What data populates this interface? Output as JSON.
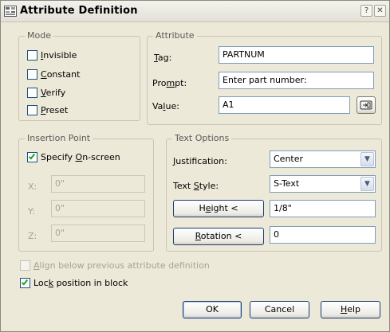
{
  "window": {
    "title": "Attribute Definition",
    "help_glyph": "?",
    "close_glyph": "✕"
  },
  "mode": {
    "group_label": "Mode",
    "items": [
      {
        "label": "Invisible",
        "checked": false
      },
      {
        "label": "Constant",
        "checked": false
      },
      {
        "label": "Verify",
        "checked": false
      },
      {
        "label": "Preset",
        "checked": false
      }
    ]
  },
  "attribute": {
    "group_label": "Attribute",
    "tag_label": "Tag:",
    "tag_value": "PARTNUM",
    "prompt_label": "Prompt:",
    "prompt_value": "Enter part number:",
    "value_label": "Value:",
    "value_value": "A1"
  },
  "insertion": {
    "group_label": "Insertion Point",
    "specify_label": "Specify On-screen",
    "specify_checked": true,
    "x_label": "X:",
    "x_value": "0\"",
    "y_label": "Y:",
    "y_value": "0\"",
    "z_label": "Z:",
    "z_value": "0\""
  },
  "text_options": {
    "group_label": "Text Options",
    "justification_label": "Justification:",
    "justification_value": "Center",
    "style_label": "Text Style:",
    "style_value": "S-Text",
    "height_button": "Height <",
    "height_value": "1/8\"",
    "rotation_button": "Rotation <",
    "rotation_value": "0"
  },
  "options": {
    "align_label": "Align below previous attribute definition",
    "align_checked": false,
    "lock_label": "Lock position in block",
    "lock_checked": true
  },
  "footer": {
    "ok": "OK",
    "cancel": "Cancel",
    "help": "Help"
  }
}
